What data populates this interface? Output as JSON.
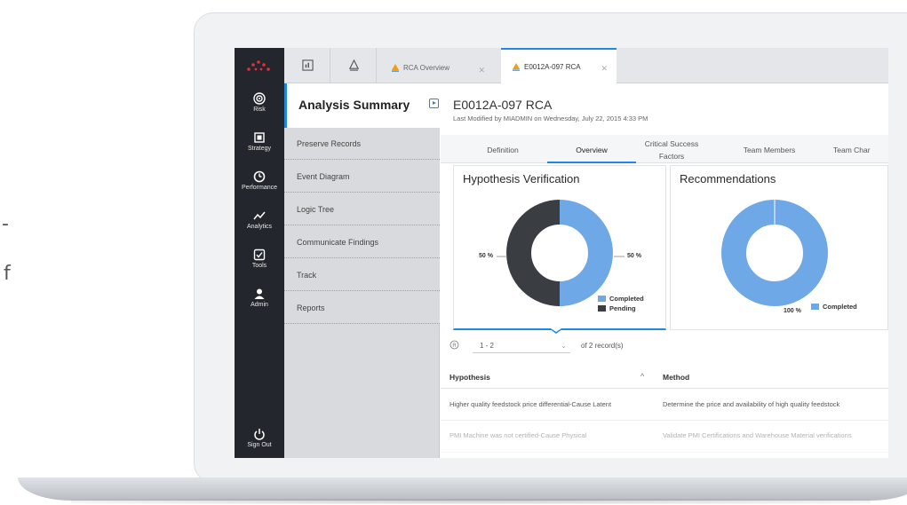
{
  "nav": {
    "items": [
      {
        "label": "Risk",
        "icon": "target-icon"
      },
      {
        "label": "Strategy",
        "icon": "strategy-icon"
      },
      {
        "label": "Performance",
        "icon": "gauge-icon"
      },
      {
        "label": "Analytics",
        "icon": "trend-line-icon"
      },
      {
        "label": "Tools",
        "icon": "checkbox-tools-icon"
      },
      {
        "label": "Admin",
        "icon": "user-icon"
      }
    ],
    "signout": "Sign Out"
  },
  "tabs": [
    {
      "label": "RCA Overview"
    },
    {
      "label": "E0012A-097 RCA"
    }
  ],
  "sidebar": {
    "title": "Analysis Summary",
    "items": [
      "Preserve Records",
      "Event Diagram",
      "Logic Tree",
      "Communicate Findings",
      "Track",
      "Reports"
    ]
  },
  "record": {
    "title": "E0012A-097 RCA",
    "subtitle": "Last Modified by MIADMIN on Wednesday, July 22, 2015 4:33 PM"
  },
  "subtabs": [
    "Definition",
    "Overview",
    "Critical Success Factors",
    "Team Members",
    "Team Char"
  ],
  "cards": {
    "hypothesis": {
      "title": "Hypothesis Verification",
      "left_pct": "50 %",
      "right_pct": "50 %",
      "legend": [
        "Completed",
        "Pending"
      ]
    },
    "recommendations": {
      "title": "Recommendations",
      "pct": "100 %",
      "legend": "Completed"
    }
  },
  "chart_data": [
    {
      "type": "pie",
      "title": "Hypothesis Verification",
      "categories": [
        "Completed",
        "Pending"
      ],
      "values": [
        50,
        50
      ]
    },
    {
      "type": "pie",
      "title": "Recommendations",
      "categories": [
        "Completed"
      ],
      "values": [
        100
      ]
    }
  ],
  "pager": {
    "range": "1 - 2",
    "of": "of 2 record(s)"
  },
  "table": {
    "headers": [
      "Hypothesis",
      "Method"
    ],
    "rows": [
      [
        "Higher quality feedstock price differential-Cause Latent",
        "Determine the price and availability of high quality feedstock"
      ],
      [
        "PMI Machine was not certified-Cause Physical",
        "Validate PMI Certifications and Warehouse Material verifications"
      ]
    ]
  },
  "colors": {
    "completed": "#6fa8e6",
    "pending": "#3a3d42",
    "accent": "#1e88e5",
    "nav_bg": "#23272d"
  },
  "page_fragment": {
    "line1": "-",
    "line2": "f"
  }
}
